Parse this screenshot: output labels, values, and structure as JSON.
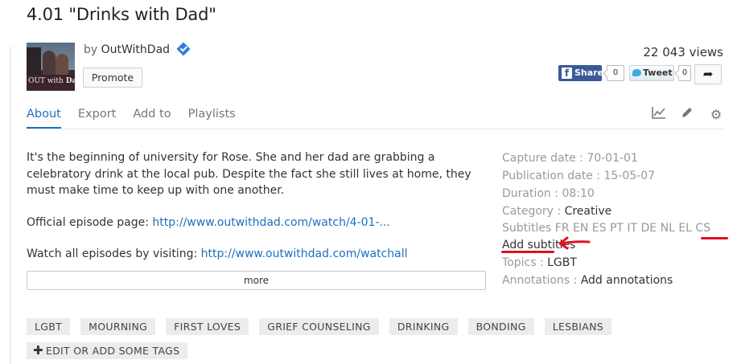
{
  "video": {
    "title": "4.01 \"Drinks with Dad\"",
    "by_prefix": "by",
    "owner": "OutWithDad",
    "promote_label": "Promote",
    "views": "22 043 views",
    "thumbnail_text_1": "OUT with",
    "thumbnail_text_2": "Dad"
  },
  "social": {
    "share_label": "Share",
    "share_count": "0",
    "tweet_label": "Tweet",
    "tweet_count": "0"
  },
  "tabs": [
    {
      "label": "About"
    },
    {
      "label": "Export"
    },
    {
      "label": "Add to"
    },
    {
      "label": "Playlists"
    }
  ],
  "tools": {
    "stats_icon": "chart-icon",
    "edit_icon": "pencil-icon",
    "settings_icon": "gear-icon"
  },
  "description": {
    "p1": "It's the beginning of university for Rose. She and her dad are grabbing a celebratory drink at the local pub. Despite the fact she still lives at home, they must make time to keep up with one another.",
    "p2_prefix": "Official episode page: ",
    "p2_link": "http://www.outwithdad.com/watch/4-01-...",
    "p3_prefix": "Watch all episodes by visiting: ",
    "p3_link": "http://www.outwithdad.com/watchall",
    "more_label": "more"
  },
  "meta": {
    "capture_label": "Capture date : ",
    "capture_value": "70-01-01",
    "publication_label": "Publication date : ",
    "publication_value": "15-05-07",
    "duration_label": "Duration : ",
    "duration_value": "08:10",
    "category_label": "Category : ",
    "category_value": "Creative",
    "subtitles_label": "Subtitles ",
    "subtitles_langs": "FR EN ES PT IT DE NL EL CS",
    "add_subtitles": "Add subtitles",
    "topics_label": "Topics : ",
    "topics_value": "LGBT",
    "annotations_label": "Annotations : ",
    "annotations_value": "Add annotations"
  },
  "tags": [
    "LGBT",
    "MOURNING",
    "FIRST LOVES",
    "GRIEF COUNSELING",
    "DRINKING",
    "BONDING",
    "LESBIANS"
  ],
  "add_tag_label": "EDIT OR ADD SOME TAGS",
  "colors": {
    "link": "#1f6fbf",
    "facebook": "#3b5998",
    "annotation_red": "#e0101b"
  }
}
